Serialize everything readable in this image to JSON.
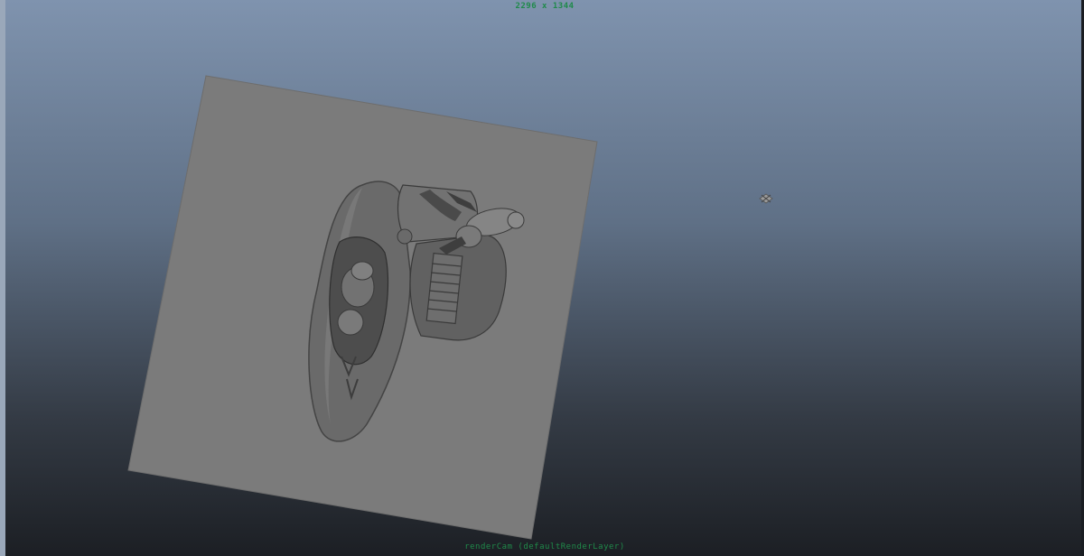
{
  "viewport": {
    "resolution_label": "2296 x 1344",
    "camera_label": "renderCam (defaultRenderLayer)"
  },
  "scene": {
    "ground_plane_color": "#7b7b7b",
    "model_color": "#6c6c6c",
    "model_shadow_color": "#3f3f3f",
    "locator_icon": "camera-locator-icon"
  },
  "colors": {
    "hud_text": "#1f8a4a",
    "background_top": "#7f93ae",
    "background_bottom": "#1c1f24"
  }
}
